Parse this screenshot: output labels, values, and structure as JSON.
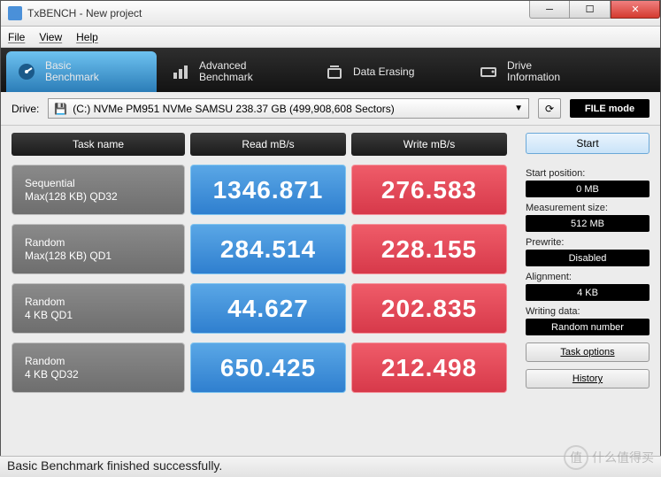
{
  "window": {
    "title": "TxBENCH - New project"
  },
  "menu": {
    "file": "File",
    "view": "View",
    "help": "Help"
  },
  "tabs": {
    "basic": "Basic\nBenchmark",
    "advanced": "Advanced\nBenchmark",
    "erase": "Data Erasing",
    "drive": "Drive\nInformation"
  },
  "toolbar": {
    "drive_label": "Drive:",
    "drive_value": "(C:) NVMe PM951 NVMe SAMSU  238.37 GB (499,908,608 Sectors)",
    "filemode": "FILE mode"
  },
  "headers": {
    "task": "Task name",
    "read": "Read mB/s",
    "write": "Write mB/s"
  },
  "rows": [
    {
      "name1": "Sequential",
      "name2": "Max(128 KB) QD32",
      "read": "1346.871",
      "write": "276.583"
    },
    {
      "name1": "Random",
      "name2": "Max(128 KB) QD1",
      "read": "284.514",
      "write": "228.155"
    },
    {
      "name1": "Random",
      "name2": "4 KB QD1",
      "read": "44.627",
      "write": "202.835"
    },
    {
      "name1": "Random",
      "name2": "4 KB QD32",
      "read": "650.425",
      "write": "212.498"
    }
  ],
  "sidebar": {
    "start": "Start",
    "startpos_lbl": "Start position:",
    "startpos_val": "0 MB",
    "msize_lbl": "Measurement size:",
    "msize_val": "512 MB",
    "prewrite_lbl": "Prewrite:",
    "prewrite_val": "Disabled",
    "align_lbl": "Alignment:",
    "align_val": "4 KB",
    "wdata_lbl": "Writing data:",
    "wdata_val": "Random number",
    "taskopt": "Task options",
    "history": "History"
  },
  "status": "Basic Benchmark finished successfully.",
  "watermark": "什么值得买"
}
